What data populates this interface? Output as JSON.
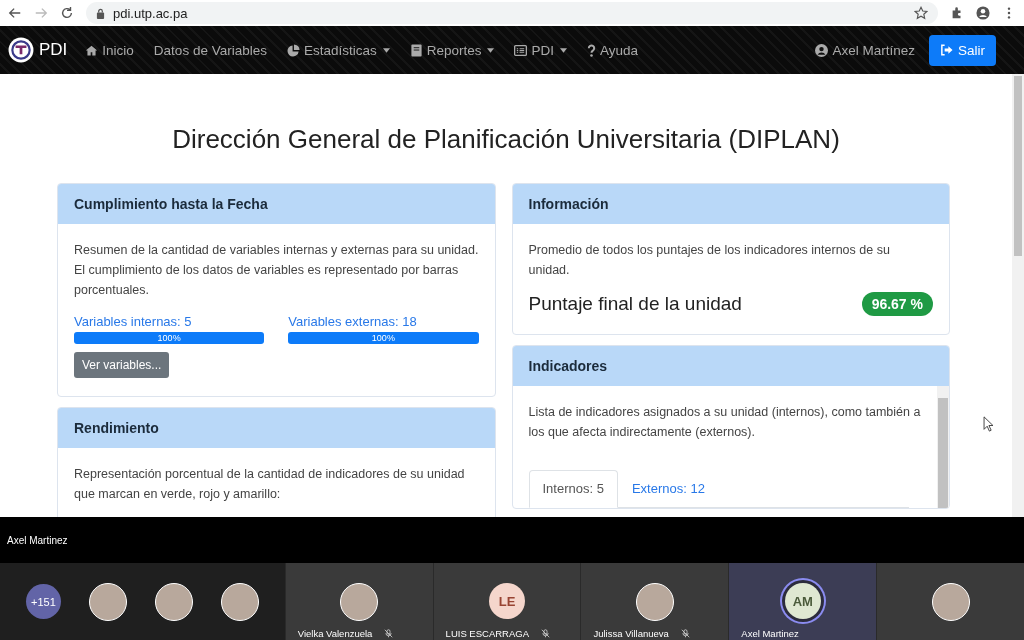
{
  "browser": {
    "url": "pdi.utp.ac.pa"
  },
  "navbar": {
    "brand": "PDI",
    "items": [
      {
        "label": "Inicio",
        "kind": "home",
        "dropdown": false
      },
      {
        "label": "Datos de Variables",
        "kind": "plain",
        "dropdown": false
      },
      {
        "label": "Estadísticas",
        "kind": "chart",
        "dropdown": true
      },
      {
        "label": "Reportes",
        "kind": "book",
        "dropdown": true
      },
      {
        "label": "PDI",
        "kind": "list",
        "dropdown": true
      },
      {
        "label": "Ayuda",
        "kind": "help",
        "dropdown": false
      }
    ],
    "user": "Axel Martínez",
    "logout": "Salir"
  },
  "page_title": "Dirección General de Planificación Universitaria (DIPLAN)",
  "cumplimiento": {
    "title": "Cumplimiento hasta la Fecha",
    "text": "Resumen de la cantidad de variables internas y externas para su unidad. El cumplimiento de los datos de variables es representado por barras porcentuales.",
    "variables": [
      {
        "label": "Variables internas:",
        "count": "5",
        "level": 1,
        "reading": "100%"
      },
      {
        "label": "Variables externas:",
        "count": "18",
        "level": 1,
        "reading": "100%"
      }
    ],
    "button": "Ver variables..."
  },
  "rendimiento": {
    "title": "Rendimiento",
    "text": "Representación porcentual de la cantidad de indicadores de su unidad que marcan en verde, rojo y amarillo:"
  },
  "informacion": {
    "title": "Información",
    "text": "Promedio de todos los puntajes de los indicadores internos de su unidad.",
    "score_label": "Puntaje final de la unidad",
    "score": "96.67 %"
  },
  "indicadores": {
    "title": "Indicadores",
    "text": "Lista de indicadores asignados a su unidad (internos), como también a los que afecta indirectamente (externos).",
    "tabs": [
      {
        "label": "Internos: 5",
        "selected": true
      },
      {
        "label": "Externos: 12",
        "selected": false
      }
    ]
  },
  "meeting": {
    "speaker": "Axel Martinez",
    "overflow": "+151",
    "avatars": [
      {
        "kind": "photo"
      },
      {
        "kind": "photo"
      },
      {
        "kind": "photo"
      }
    ],
    "tiles": [
      {
        "name": "Vielka Valenzuela",
        "kind": "photo",
        "muted": true,
        "speaking": false
      },
      {
        "name": "LUIS ESCARRAGA",
        "kind": "initials",
        "initials": "LE",
        "muted": true,
        "speaking": false
      },
      {
        "name": "Julissa Villanueva",
        "kind": "photo",
        "muted": true,
        "speaking": false
      },
      {
        "name": "Axel Martinez",
        "kind": "initials",
        "initials": "AM",
        "muted": false,
        "speaking": true
      },
      {
        "kind": "photo",
        "muted": false,
        "speaking": false
      }
    ]
  }
}
